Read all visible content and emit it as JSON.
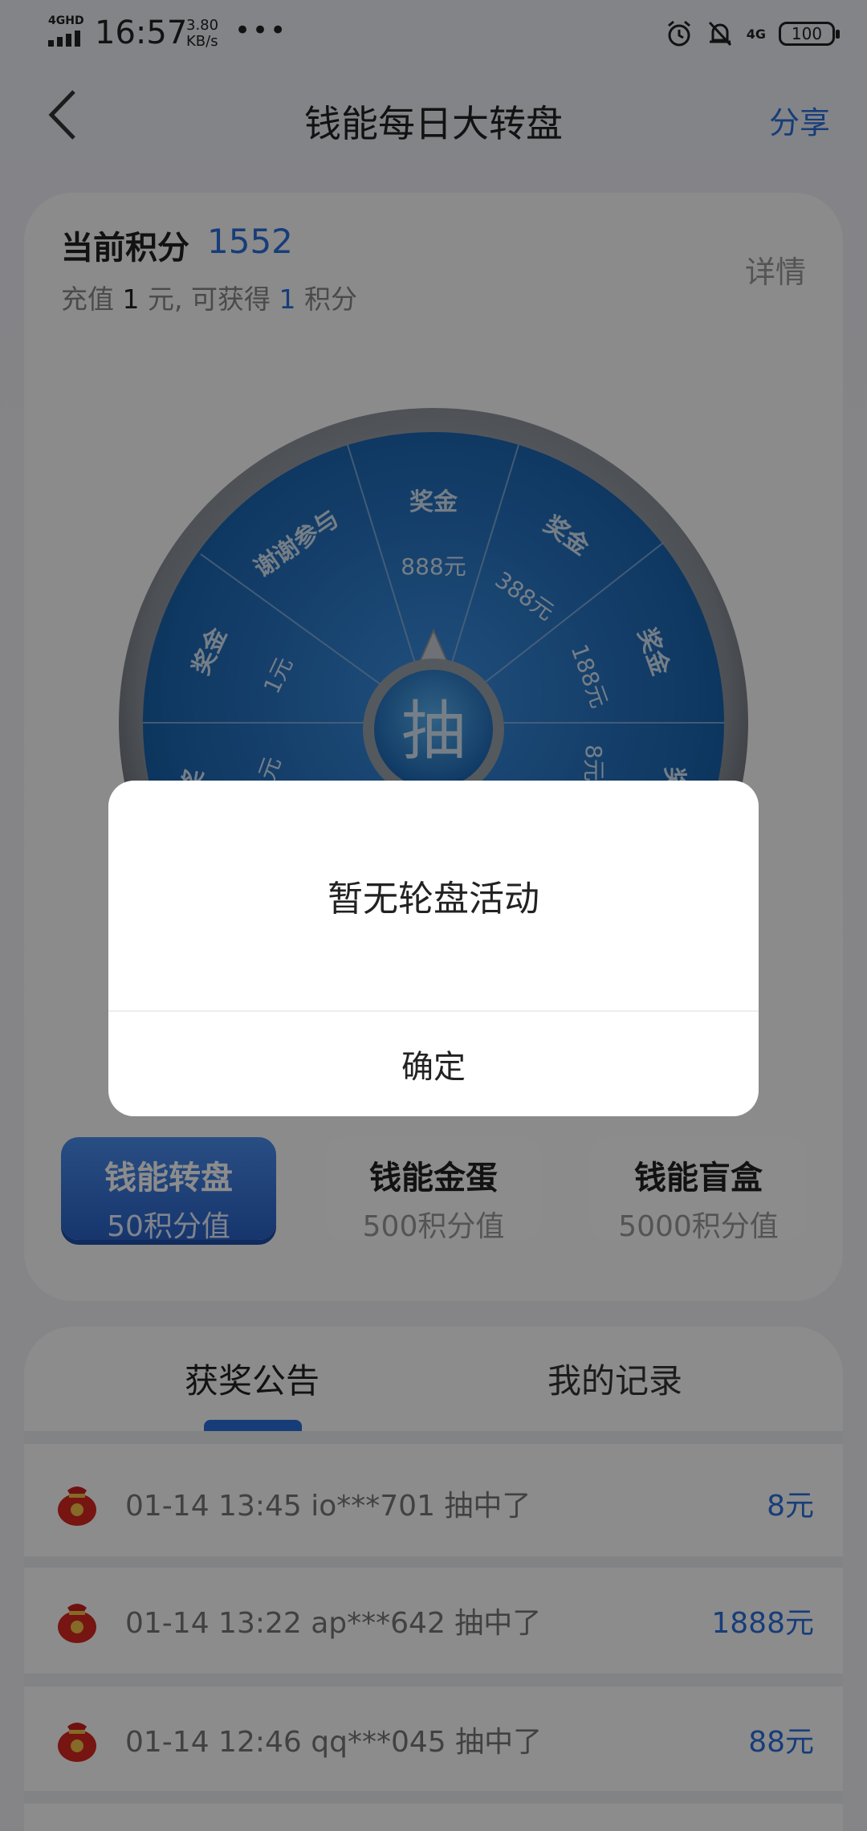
{
  "status_bar": {
    "network": "4GHD",
    "time": "16:57",
    "speed_value": "3.80",
    "speed_unit": "KB/s",
    "more": "•••",
    "signal_right": "4G",
    "battery": "100"
  },
  "nav": {
    "title": "钱能每日大转盘",
    "share": "分享",
    "back_icon": "chevron-left-icon"
  },
  "points": {
    "label": "当前积分",
    "value": "1552",
    "recharge_prefix": "充值",
    "recharge_amount": "1",
    "recharge_mid": "元, 可获得",
    "recharge_points": "1",
    "recharge_suffix": "积分",
    "details": "详情"
  },
  "wheel": {
    "center": "抽",
    "segments": [
      {
        "title": "奖金",
        "amount": "888元"
      },
      {
        "title": "奖金",
        "amount": "388元"
      },
      {
        "title": "奖金",
        "amount": "188元"
      },
      {
        "title": "奖",
        "amount": "8元"
      },
      {
        "title": "奖",
        "amount": "元"
      },
      {
        "title": "奖金",
        "amount": "1元"
      },
      {
        "title": "谢谢参与",
        "amount": ""
      }
    ]
  },
  "games": [
    {
      "title": "钱能转盘",
      "sub": "50积分值"
    },
    {
      "title": "钱能金蛋",
      "sub": "500积分值"
    },
    {
      "title": "钱能盲盒",
      "sub": "5000积分值"
    }
  ],
  "tabs": {
    "announce": "获奖公告",
    "records": "我的记录"
  },
  "records": [
    {
      "text": "01-14 13:45 io***701 抽中了",
      "amount": "8元"
    },
    {
      "text": "01-14 13:22 ap***642 抽中了",
      "amount": "1888元"
    },
    {
      "text": "01-14 12:46 qq***045 抽中了",
      "amount": "88元"
    }
  ],
  "dialog": {
    "message": "暂无轮盘活动",
    "confirm": "确定"
  },
  "colors": {
    "accent": "#2a6fdc",
    "wheel_blue": "#1f73c8",
    "overlay": "rgba(0,0,0,0.45)"
  }
}
